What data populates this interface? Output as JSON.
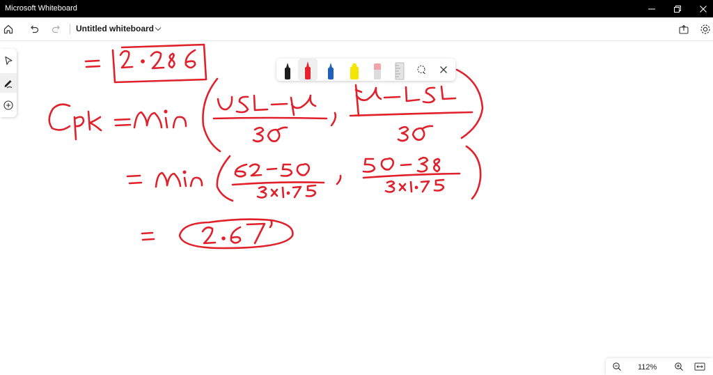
{
  "window": {
    "title": "Microsoft Whiteboard"
  },
  "toolbar": {
    "doc_title": "Untitled whiteboard"
  },
  "left_rail": {
    "items": [
      "select",
      "inking",
      "add"
    ]
  },
  "pen_tray": {
    "pens": [
      {
        "name": "black-pen",
        "color": "#1e1e1e"
      },
      {
        "name": "red-pen",
        "color": "#e8212e"
      },
      {
        "name": "blue-pen",
        "color": "#1f5fbf"
      },
      {
        "name": "yellow-highlighter",
        "color": "#f2e600"
      },
      {
        "name": "pink-eraser",
        "color": "#f3a3a8"
      },
      {
        "name": "ruler",
        "color": "#bdbdbd"
      }
    ]
  },
  "ink": {
    "color": "#e0202a",
    "lines": [
      "= 2·286",
      "Cpk = Min( (USL−μ)/3σ , (μ−LSL)/3σ )",
      "= Min( (62−50)/(3×1·75) , (50−38)/(3×1·75) )",
      "= 2·67"
    ]
  },
  "zoom": {
    "level": "112%"
  }
}
